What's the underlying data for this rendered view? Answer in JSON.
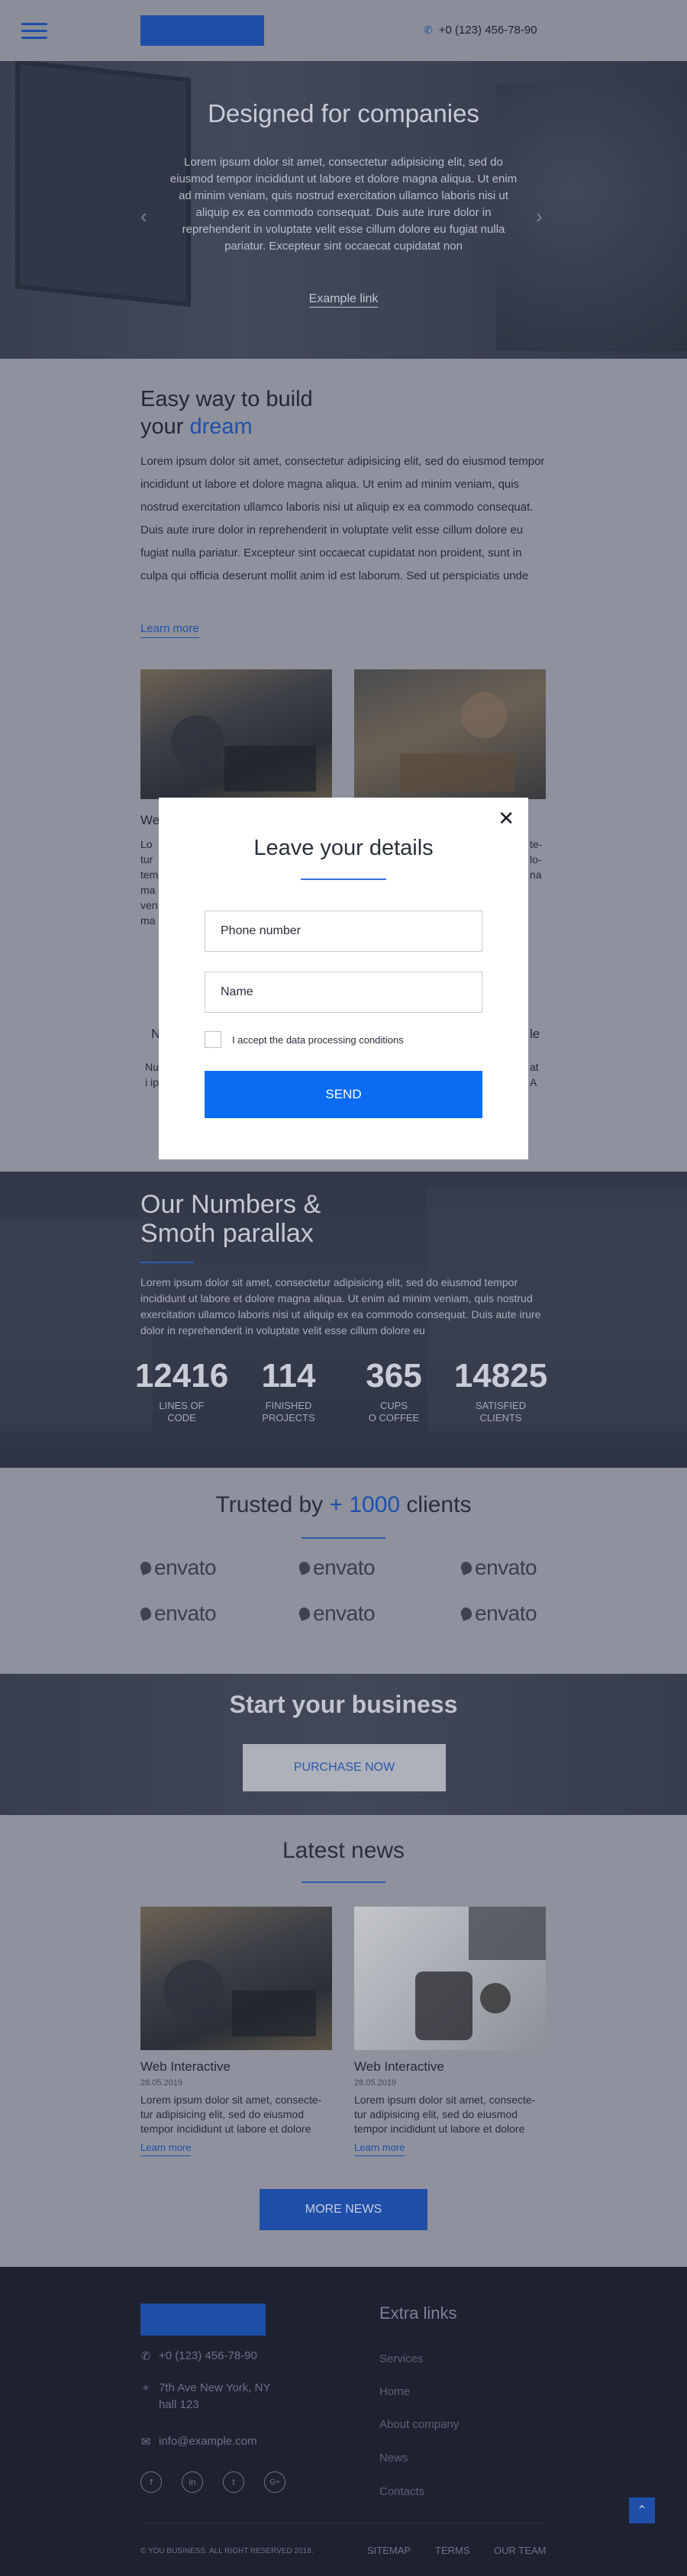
{
  "header": {
    "phone": "+0 (123) 456-78-90"
  },
  "hero": {
    "title": "Designed for companies",
    "text": "Lorem ipsum dolor sit amet, consectetur adipisicing elit, sed do eiusmod tempor incididunt ut labore et dolore magna aliqua. Ut enim ad minim veniam, quis nostrud exercitation ullamco laboris nisi ut aliquip ex ea commodo consequat. Duis aute irure dolor in reprehenderit in voluptate velit esse cillum dolore eu fugiat nulla pariatur. Excepteur sint occaecat cupidatat non",
    "link": "Example link",
    "prev": "‹",
    "next": "›"
  },
  "easy": {
    "title_line1": "Easy way to build",
    "title_line2_prefix": "your ",
    "title_highlight": "dream",
    "text": "Lorem ipsum dolor sit amet, consectetur adipisicing elit, sed do eiusmod tempor incididunt ut labore et dolore magna aliqua. Ut enim ad minim veniam, quis nostrud exercitation ullamco laboris nisi ut aliquip ex ea commodo consequat. Duis aute irure dolor in reprehenderit in voluptate velit esse cillum dolore eu fugiat nulla pariatur. Excepteur sint occaecat cupidatat non proident, sunt in culpa qui officia deserunt mollit anim id est laborum. Sed ut perspiciatis unde",
    "learn_more": "Learn more",
    "card_left_title": "We",
    "card_left_text": "Lo tur tem ma ven ma",
    "card_right_text": "te- lo- na"
  },
  "mid": {
    "left_letter": "N",
    "left_text": "Nu i ip",
    "right_word": "le",
    "right_text": "at A"
  },
  "numbers": {
    "title_line1": "Our Numbers &",
    "title_line2": "Smoth parallax",
    "text": "Lorem ipsum dolor sit amet, consectetur adipisicing elit, sed do eiusmod tempor incididunt ut labore et dolore magna aliqua. Ut enim ad minim veniam, quis nostrud exercitation ullamco laboris nisi ut aliquip ex ea commodo consequat. Duis aute irure dolor in reprehenderit in voluptate velit esse cillum dolore eu",
    "stats": [
      {
        "value": "12416",
        "label1": "LINES OF",
        "label2": "CODE"
      },
      {
        "value": "114",
        "label1": "FINISHED",
        "label2": "PROJECTS"
      },
      {
        "value": "365",
        "label1": "CUPS",
        "label2": "O COFFEE"
      },
      {
        "value": "14825",
        "label1": "SATISFIED",
        "label2": "CLIENTS"
      }
    ]
  },
  "trusted": {
    "prefix": "Trusted by ",
    "highlight": "+ 1000",
    "suffix": " clients",
    "logo_word": "envato"
  },
  "business": {
    "title": "Start your business",
    "button": "PURCHASE NOW"
  },
  "news": {
    "title": "Latest news",
    "items": [
      {
        "title": "Web Interactive",
        "date": "28.05.2019",
        "text": "Lorem ipsum dolor sit amet, consecte-tur adipisicing elit, sed do eiusmod tempor incididunt ut labore et dolore",
        "link": "Learn more"
      },
      {
        "title": "Web Interactive",
        "date": "28.05.2019",
        "text": "Lorem ipsum dolor sit amet, consecte-tur adipisicing elit, sed do eiusmod tempor incididunt ut labore et dolore",
        "link": "Learn more"
      }
    ],
    "more_button": "MORE NEWS"
  },
  "footer": {
    "phone": "+0 (123) 456-78-90",
    "address_line1": "7th Ave New York, NY",
    "address_line2": "hall 123",
    "email": "info@example.com",
    "social": [
      "f",
      "in",
      "t",
      "G+"
    ],
    "extra_title": "Extra links",
    "links": [
      "Services",
      "Home",
      "About company",
      "News",
      "Contacts"
    ],
    "copyright": "© YOU BUSINESS. ALL RIGHT RESERVED 2018.",
    "bottom_links": [
      "SITEMAP",
      "TERMS",
      "OUR TEAM"
    ],
    "scroll_top": "⌃"
  },
  "modal": {
    "title": "Leave your details",
    "close": "✕",
    "phone_placeholder": "Phone number",
    "name_placeholder": "Name",
    "checkbox_label": "I accept the data processing conditions",
    "send": "SEND"
  },
  "colors": {
    "accent": "#1f4fa8",
    "send_button": "#0a6cf2",
    "footer_bg": "#1d2130"
  }
}
